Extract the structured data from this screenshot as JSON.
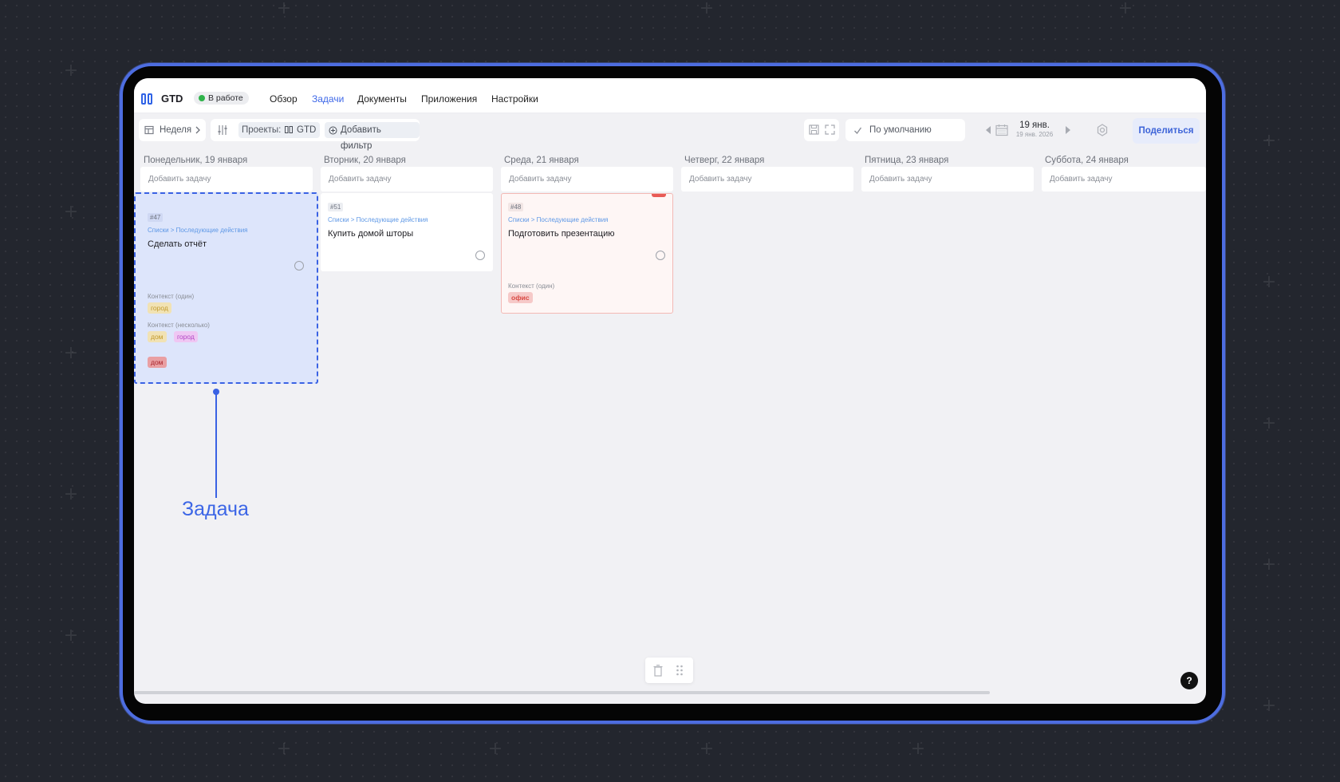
{
  "app": {
    "title": "GTD",
    "status": "В работе",
    "nav": [
      "Обзор",
      "Задачи",
      "Документы",
      "Приложения",
      "Настройки"
    ],
    "active_nav": "Задачи"
  },
  "toolbar": {
    "view": "Неделя",
    "projects_label": "Проекты:",
    "project_chip": "GTD",
    "add_filter": "Добавить фильтр",
    "sort": "По умолчанию",
    "date": "19 янв.",
    "date_sub": "19 янв. 2026",
    "share": "Поделиться"
  },
  "columns": [
    {
      "title": "Понедельник, 19 января",
      "add": "Добавить задачу"
    },
    {
      "title": "Вторник, 20 января",
      "add": "Добавить задачу"
    },
    {
      "title": "Среда, 21 января",
      "add": "Добавить задачу"
    },
    {
      "title": "Четверг, 22 января",
      "add": "Добавить задачу"
    },
    {
      "title": "Пятница, 23 января",
      "add": "Добавить задачу"
    },
    {
      "title": "Суббота, 24 января",
      "add": "Добавить задачу"
    }
  ],
  "cards": [
    {
      "id": "#47",
      "crumb": "Списки > Последующие действия",
      "title": "Сделать отчёт",
      "ctx_one_label": "Контекст (один)",
      "ctx_one": "город",
      "ctx_many_label": "Контекст (несколько)",
      "ctx_many": [
        "дом",
        "город"
      ],
      "extra_tag": "дом"
    },
    {
      "id": "#51",
      "crumb": "Списки > Последующие действия",
      "title": "Купить домой шторы"
    },
    {
      "id": "#48",
      "crumb": "Списки > Последующие действия",
      "title": "Подготовить презентацию",
      "ctx_one_label": "Контекст (один)",
      "ctx_one": "офис"
    }
  ],
  "help": "?",
  "callout": "Задача",
  "colors": {
    "accent": "#3e68e8",
    "frame": "#4d6de0",
    "background": "#23262e"
  }
}
